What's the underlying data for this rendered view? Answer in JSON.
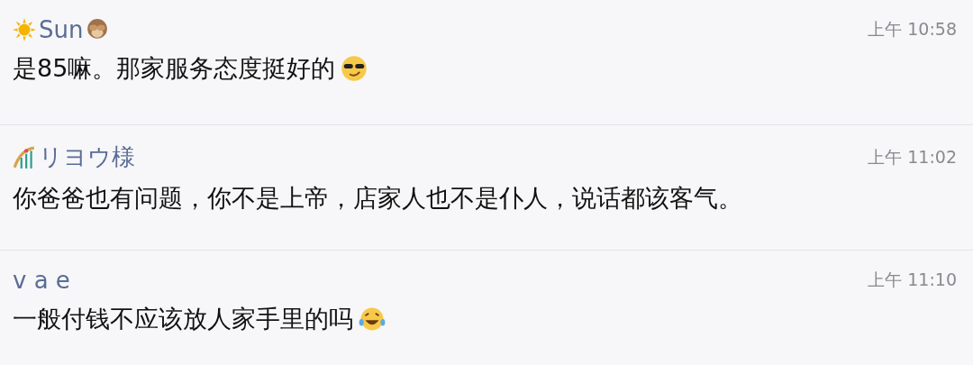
{
  "comments": [
    {
      "name": "Sun",
      "time": "上午 10:58",
      "text": "是85嘛。那家服务态度挺好的"
    },
    {
      "name": "リヨウ様",
      "time": "上午 11:02",
      "text": "你爸爸也有问题，你不是上帝，店家人也不是仆人，说话都该客气。"
    },
    {
      "name": "v a e",
      "time": "上午 11:10",
      "text": "一般付钱不应该放人家手里的吗"
    }
  ]
}
